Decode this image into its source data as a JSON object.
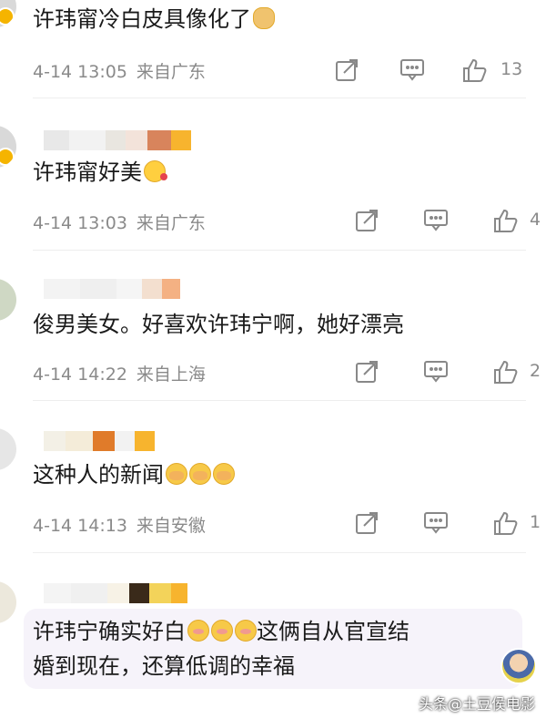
{
  "comments": [
    {
      "text": "许玮甯冷白皮具像化了",
      "emoji": [
        "doge-emoji"
      ],
      "time": "4-14 13:05",
      "location": "来自广东",
      "likes": "13"
    },
    {
      "text": "许玮甯好美",
      "emoji": [
        "kiss-emoji"
      ],
      "time": "4-14 13:03",
      "location": "来自广东",
      "likes": "4"
    },
    {
      "text": "俊男美女。好喜欢许玮宁啊，她好漂亮",
      "emoji": [],
      "time": "4-14 14:22",
      "location": "来自上海",
      "likes": "2"
    },
    {
      "text": "这种人的新闻",
      "emoji": [
        "cover-mouth-emoji",
        "cover-mouth-emoji",
        "cover-mouth-emoji"
      ],
      "time": "4-14 14:13",
      "location": "来自安徽",
      "likes": "1"
    },
    {
      "text_line1": "许玮宁确实好白",
      "text_line1_after": "这俩自从官宣结",
      "text_line2": "婚到现在，还算低调的幸福",
      "emoji": [
        "shy-emoji",
        "shy-emoji",
        "shy-emoji"
      ]
    }
  ],
  "watermark": "头条@土豆侯电影",
  "colors": {
    "meta_text": "#8a8a8a",
    "icon": "#888888",
    "badge": "#f5b400",
    "bubble": "#f6f3fa"
  },
  "icons": {
    "share": "share-icon",
    "reply": "comment-icon",
    "like": "thumbs-up-icon"
  }
}
